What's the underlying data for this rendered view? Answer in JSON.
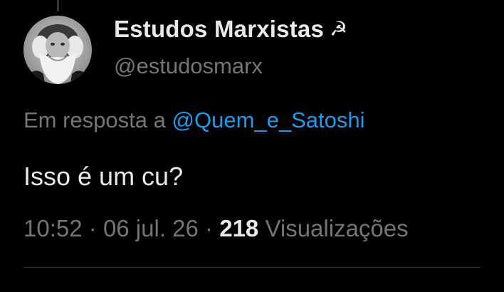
{
  "author": {
    "display_name": "Estudos Marxistas",
    "name_emoji": "☭",
    "handle": "@estudosmarx",
    "avatar_icon": "portrait-avatar"
  },
  "reply": {
    "prefix": "Em resposta a",
    "mention": "@Quem_e_Satoshi"
  },
  "tweet": {
    "text": "Isso é um cu?"
  },
  "meta": {
    "time": "10:52",
    "separator": "·",
    "date": "06 jul. 26",
    "views_count": "218",
    "views_label": "Visualizações"
  },
  "colors": {
    "background": "#000000",
    "primary_text": "#e7e9ea",
    "secondary_text": "#71767b",
    "link": "#1d9bf0",
    "divider": "#2f3336"
  }
}
